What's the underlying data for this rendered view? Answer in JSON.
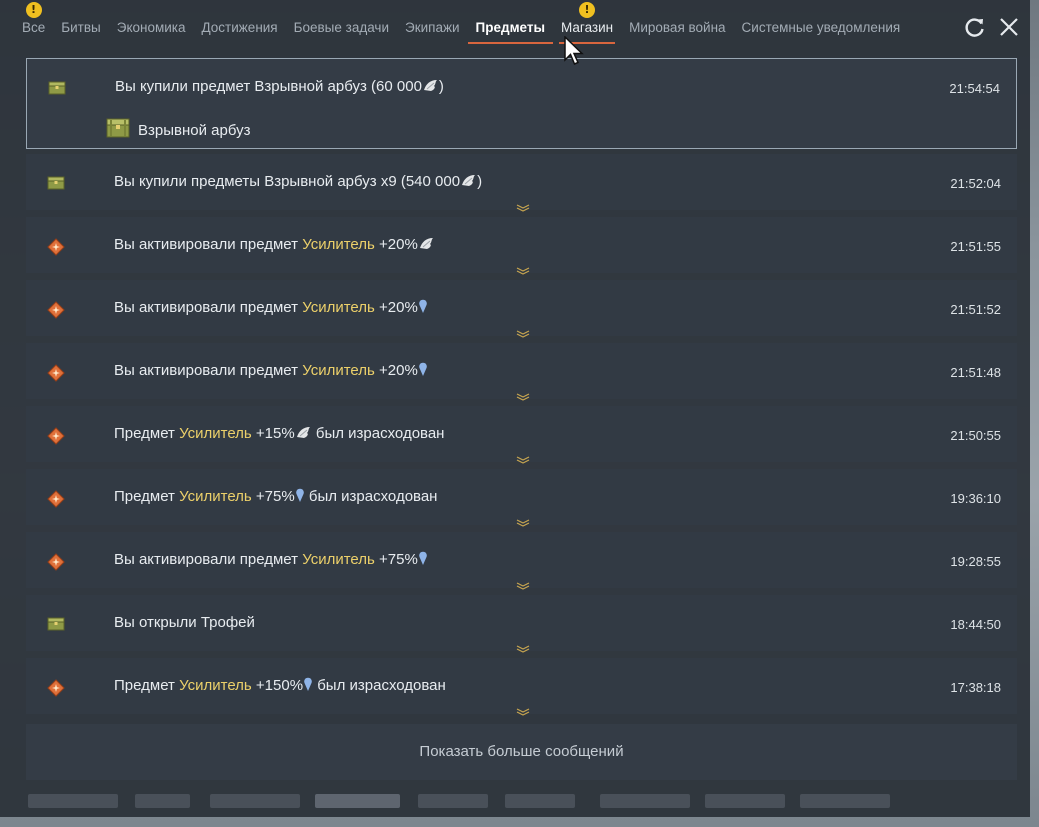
{
  "tabs": [
    {
      "label": "Все",
      "alert": true
    },
    {
      "label": "Битвы",
      "alert": false
    },
    {
      "label": "Экономика",
      "alert": false
    },
    {
      "label": "Достижения",
      "alert": false
    },
    {
      "label": "Боевые задачи",
      "alert": false
    },
    {
      "label": "Экипажи",
      "alert": false
    },
    {
      "label": "Предметы",
      "alert": false,
      "active": true
    },
    {
      "label": "Магазин",
      "alert": true
    },
    {
      "label": "Мировая война",
      "alert": false
    },
    {
      "label": "Системные уведомления",
      "alert": false
    }
  ],
  "alert_mark": "!",
  "window": {
    "refresh_icon": "refresh-icon",
    "close_icon": "close-icon"
  },
  "messages": [
    {
      "icon": "chest-icon",
      "expanded": true,
      "parts": [
        {
          "t": "Вы купили предмет Взрывной арбуз (60 000"
        },
        {
          "icon": "silver-icon"
        },
        {
          "t": ")"
        }
      ],
      "time": "21:54:54",
      "detail": {
        "icon": "chest-icon",
        "label": "Взрывной арбуз"
      }
    },
    {
      "icon": "chest-icon",
      "parts": [
        {
          "t": "Вы купили предметы Взрывной арбуз x9 (540 000"
        },
        {
          "icon": "silver-icon"
        },
        {
          "t": ")"
        }
      ],
      "time": "21:52:04"
    },
    {
      "icon": "booster-icon",
      "parts": [
        {
          "t": "Вы активировали предмет "
        },
        {
          "t": "Усилитель",
          "hl": true
        },
        {
          "t": " +20%"
        },
        {
          "icon": "silver-icon"
        }
      ],
      "time": "21:51:55"
    },
    {
      "icon": "booster-icon",
      "parts": [
        {
          "t": "Вы активировали предмет "
        },
        {
          "t": "Усилитель",
          "hl": true
        },
        {
          "t": " +20%"
        },
        {
          "icon": "rp-icon"
        }
      ],
      "time": "21:51:52"
    },
    {
      "icon": "booster-icon",
      "parts": [
        {
          "t": "Вы активировали предмет "
        },
        {
          "t": "Усилитель",
          "hl": true
        },
        {
          "t": " +20%"
        },
        {
          "icon": "rp-icon"
        }
      ],
      "time": "21:51:48"
    },
    {
      "icon": "booster-icon",
      "parts": [
        {
          "t": "Предмет "
        },
        {
          "t": "Усилитель",
          "hl": true
        },
        {
          "t": " +15%"
        },
        {
          "icon": "silver-icon"
        },
        {
          "t": " был израсходован"
        }
      ],
      "time": "21:50:55"
    },
    {
      "icon": "booster-icon",
      "parts": [
        {
          "t": "Предмет "
        },
        {
          "t": "Усилитель",
          "hl": true
        },
        {
          "t": " +75%"
        },
        {
          "icon": "rp-icon"
        },
        {
          "t": " был израсходован"
        }
      ],
      "time": "19:36:10"
    },
    {
      "icon": "booster-icon",
      "parts": [
        {
          "t": "Вы активировали предмет "
        },
        {
          "t": "Усилитель",
          "hl": true
        },
        {
          "t": " +75%"
        },
        {
          "icon": "rp-icon"
        }
      ],
      "time": "19:28:55"
    },
    {
      "icon": "chest-icon",
      "parts": [
        {
          "t": "Вы открыли Трофей"
        }
      ],
      "time": "18:44:50"
    },
    {
      "icon": "booster-icon",
      "parts": [
        {
          "t": "Предмет "
        },
        {
          "t": "Усилитель",
          "hl": true
        },
        {
          "t": " +150%"
        },
        {
          "icon": "rp-icon"
        },
        {
          "t": " был израсходован"
        }
      ],
      "time": "17:38:18"
    }
  ],
  "show_more_label": "Показать больше сообщений",
  "colors": {
    "accent": "#d9663e",
    "highlight": "#ecd06a",
    "alert": "#f0c020"
  }
}
